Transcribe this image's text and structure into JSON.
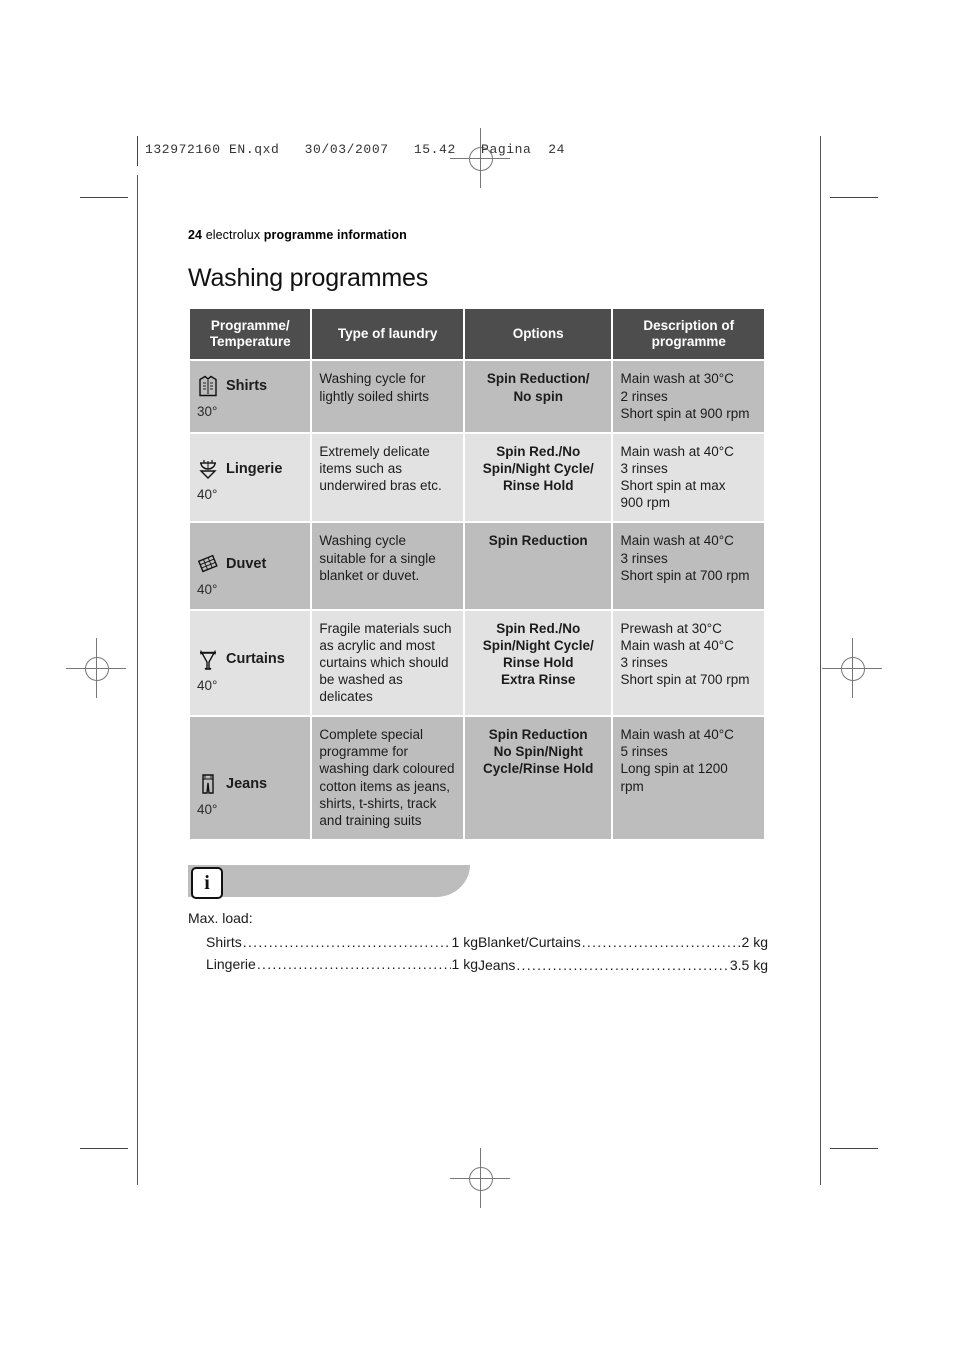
{
  "print_marks": {
    "qxd_header": "132972160 EN.qxd   30/03/2007   15.42   Pagina  24"
  },
  "page": {
    "number": "24",
    "brand": "electrolux",
    "section": "programme information",
    "title": "Washing programmes"
  },
  "table": {
    "headers": [
      "Programme/\nTemperature",
      "Type of laundry",
      "Options",
      "Description of\nprogramme"
    ],
    "headers_flat": {
      "col1_line1": "Programme/",
      "col1_line2": "Temperature",
      "col2": "Type of laundry",
      "col3": "Options",
      "col4_line1": "Description of",
      "col4_line2": "programme"
    },
    "rows": [
      {
        "icon": "shirt-icon",
        "programme": "Shirts",
        "temperature": "30°",
        "type_of_laundry": "Washing cycle for lightly soiled shirts",
        "options": "Spin Reduction/\nNo spin",
        "options_lines": [
          "Spin Reduction/",
          "No spin"
        ],
        "description": "Main wash at 30°C\n2 rinses\nShort spin at 900 rpm",
        "description_lines": [
          "Main wash at 30°C",
          "2 rinses",
          "Short spin at 900 rpm"
        ],
        "shade": "dark"
      },
      {
        "icon": "lingerie-icon",
        "programme": "Lingerie",
        "temperature": "40°",
        "type_of_laundry": "Extremely delicate items such as underwired bras etc.",
        "options": "Spin Red./No Spin/Night Cycle/ Rinse Hold",
        "options_lines": [
          "Spin Red./No",
          "Spin/Night Cycle/",
          "Rinse Hold"
        ],
        "description": "Main wash at 40°C\n3 rinses\nShort spin at max 900 rpm",
        "description_lines": [
          "Main wash at 40°C",
          "3 rinses",
          "Short spin at max",
          "900 rpm"
        ],
        "shade": "light"
      },
      {
        "icon": "duvet-icon",
        "programme": "Duvet",
        "temperature": "40°",
        "type_of_laundry": "Washing cycle suitable for a single blanket or duvet.",
        "options": "Spin Reduction",
        "options_lines": [
          "Spin Reduction"
        ],
        "description": "Main wash at 40°C\n3 rinses\nShort spin at 700 rpm",
        "description_lines": [
          "Main wash at 40°C",
          "3 rinses",
          "Short spin at 700 rpm"
        ],
        "shade": "dark"
      },
      {
        "icon": "curtains-icon",
        "programme": "Curtains",
        "temperature": "40°",
        "type_of_laundry": "Fragile materials such as acrylic and most curtains which should be washed as delicates",
        "options": "Spin Red./No Spin/Night Cycle/ Rinse Hold Extra Rinse",
        "options_lines": [
          "Spin Red./No",
          "Spin/Night Cycle/",
          "Rinse Hold",
          "Extra Rinse"
        ],
        "description": "Prewash at 30°C\nMain wash at 40°C\n3 rinses\nShort spin at 700 rpm",
        "description_lines": [
          "Prewash at 30°C",
          "Main wash at 40°C",
          "3 rinses",
          "Short spin at 700 rpm"
        ],
        "shade": "light"
      },
      {
        "icon": "jeans-icon",
        "programme": "Jeans",
        "temperature": "40°",
        "type_of_laundry": "Complete special programme for washing dark coloured cotton items as jeans, shirts, t-shirts, track and training suits",
        "options": "Spin Reduction No Spin/Night Cycle/Rinse Hold",
        "options_lines": [
          "Spin Reduction",
          "No Spin/Night",
          "Cycle/Rinse Hold"
        ],
        "description": "Main wash at 40°C\n5 rinses\nLong spin at 1200 rpm",
        "description_lines": [
          "Main wash at 40°C",
          "5 rinses",
          "Long spin at 1200",
          "rpm"
        ],
        "shade": "dark"
      }
    ]
  },
  "info": {
    "icon": "information-icon",
    "glyph": "i",
    "max_load_heading": "Max. load:",
    "left_items": [
      {
        "label": "Shirts ",
        "value": "1 kg"
      },
      {
        "label": "Lingerie",
        "value": "1 kg"
      }
    ],
    "right_items": [
      {
        "label": "Blanket/Curtains",
        "value": "2 kg"
      },
      {
        "label": "Jeans",
        "value": "3.5 kg"
      }
    ],
    "dots": "............................................................"
  },
  "colors": {
    "header_bg": "#4d4d4d",
    "row_dark": "#bdbdbd",
    "row_light": "#e2e2e2",
    "text": "#1c1c1c",
    "page_bg": "#ffffff"
  }
}
